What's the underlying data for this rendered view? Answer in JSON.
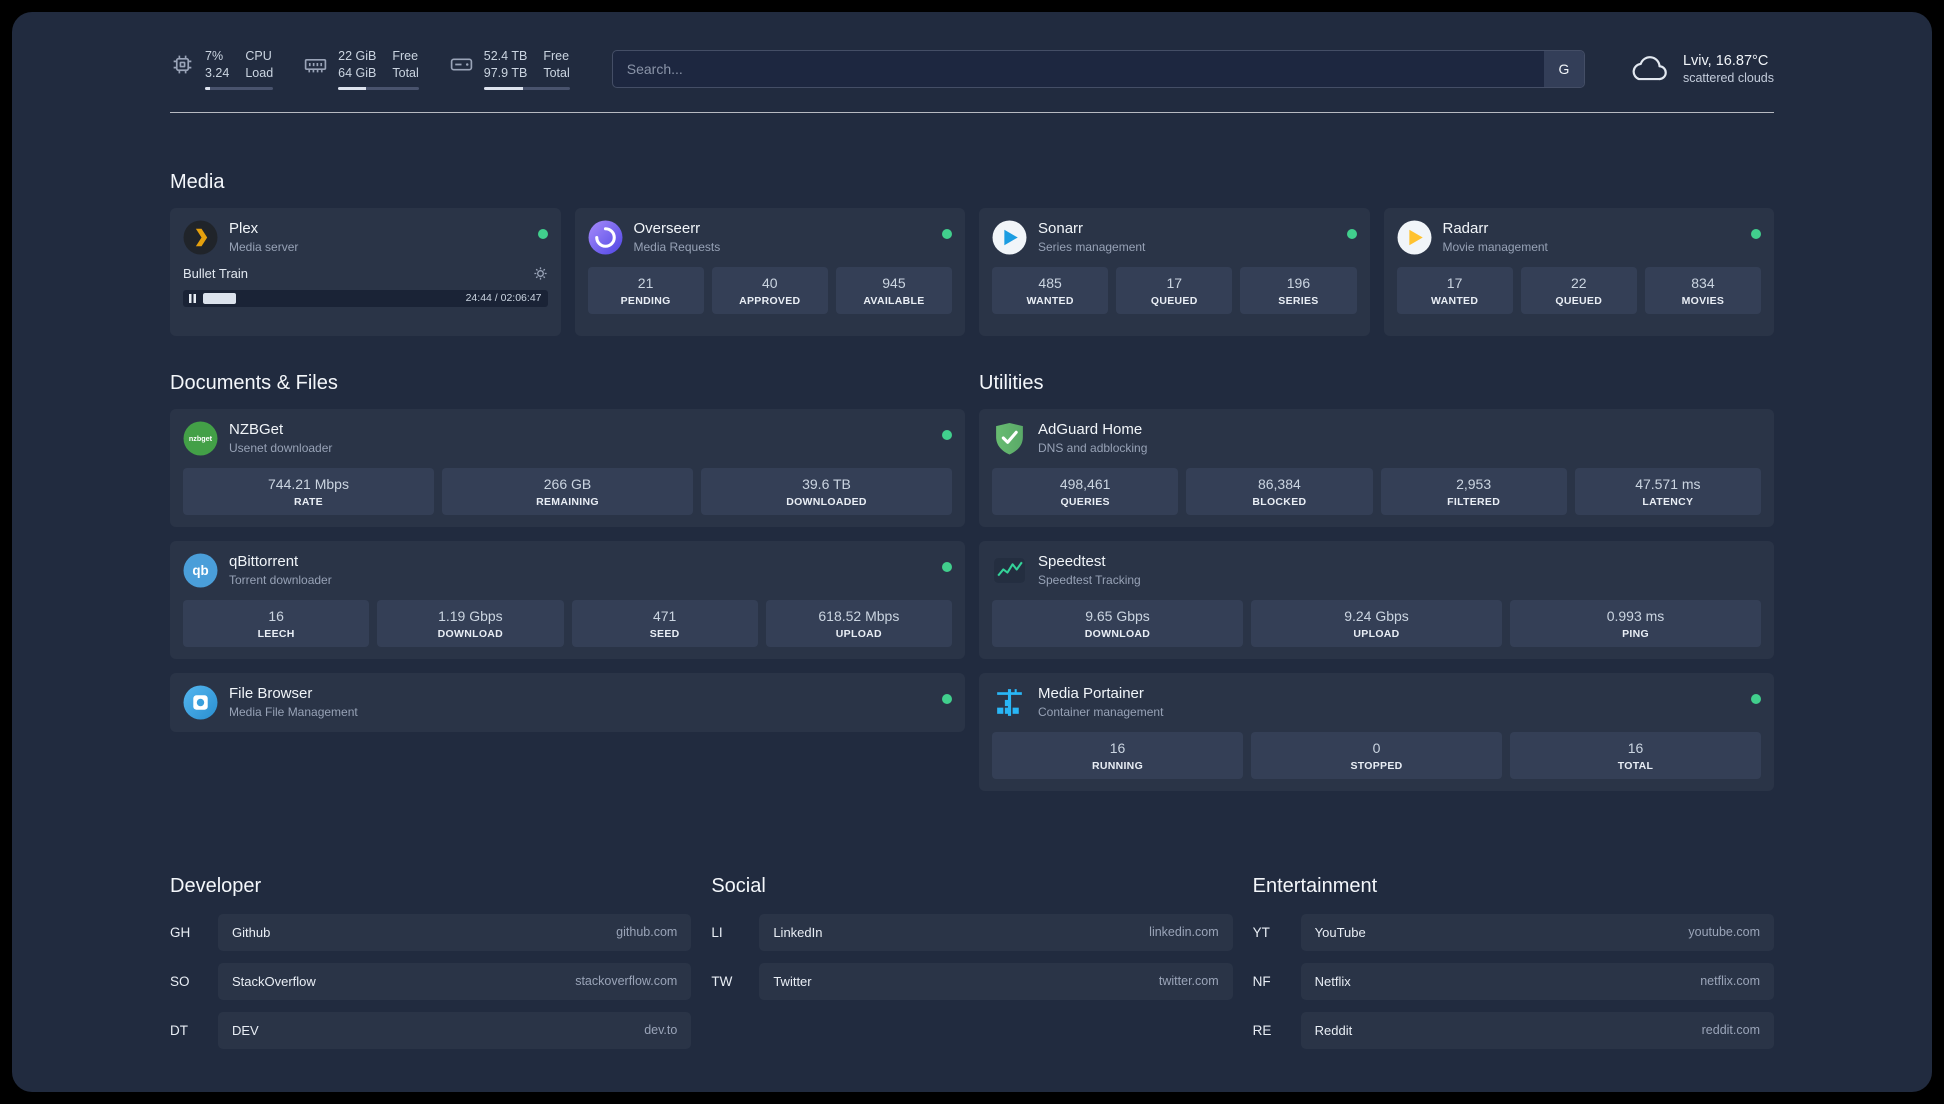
{
  "colors": {
    "accent_green": "#41cf8d",
    "page_bg": "#212b3f",
    "card_bg": "#2a3447",
    "stat_bg": "#343f56"
  },
  "header": {
    "monitors": [
      {
        "icon": "cpu-icon",
        "rows": [
          {
            "value": "7%",
            "label": "CPU"
          },
          {
            "value": "3.24",
            "label": "Load"
          }
        ],
        "progress_pct": 7
      },
      {
        "icon": "memory-icon",
        "rows": [
          {
            "value": "22 GiB",
            "label": "Free"
          },
          {
            "value": "64 GiB",
            "label": "Total"
          }
        ],
        "progress_pct": 35
      },
      {
        "icon": "disk-icon",
        "rows": [
          {
            "value": "52.4 TB",
            "label": "Free"
          },
          {
            "value": "97.9 TB",
            "label": "Total"
          }
        ],
        "progress_pct": 46
      }
    ],
    "search": {
      "placeholder": "Search...",
      "provider_button": "G"
    },
    "weather": {
      "icon": "cloud-icon",
      "location": "Lviv, 16.87°C",
      "condition": "scattered clouds"
    }
  },
  "sections": {
    "media": {
      "title": "Media",
      "plex": {
        "icon": "plex-icon",
        "name": "Plex",
        "subtitle": "Media server",
        "online": true,
        "now_playing": {
          "title": "Bullet Train",
          "time": "24:44 / 02:06:47",
          "progress_pct": 13
        }
      },
      "overseerr": {
        "icon": "overseerr-icon",
        "name": "Overseerr",
        "subtitle": "Media Requests",
        "online": true,
        "stats": [
          {
            "value": "21",
            "label": "PENDING"
          },
          {
            "value": "40",
            "label": "APPROVED"
          },
          {
            "value": "945",
            "label": "AVAILABLE"
          }
        ]
      },
      "sonarr": {
        "icon": "sonarr-icon",
        "name": "Sonarr",
        "subtitle": "Series management",
        "online": true,
        "stats": [
          {
            "value": "485",
            "label": "WANTED"
          },
          {
            "value": "17",
            "label": "QUEUED"
          },
          {
            "value": "196",
            "label": "SERIES"
          }
        ]
      },
      "radarr": {
        "icon": "radarr-icon",
        "name": "Radarr",
        "subtitle": "Movie management",
        "online": true,
        "stats": [
          {
            "value": "17",
            "label": "WANTED"
          },
          {
            "value": "22",
            "label": "QUEUED"
          },
          {
            "value": "834",
            "label": "MOVIES"
          }
        ]
      }
    },
    "documents": {
      "title": "Documents & Files",
      "nzbget": {
        "icon": "nzbget-icon",
        "icon_text": "nzbget",
        "name": "NZBGet",
        "subtitle": "Usenet downloader",
        "online": true,
        "stats": [
          {
            "value": "744.21 Mbps",
            "label": "RATE"
          },
          {
            "value": "266 GB",
            "label": "REMAINING"
          },
          {
            "value": "39.6 TB",
            "label": "DOWNLOADED"
          }
        ]
      },
      "qbittorrent": {
        "icon": "qbittorrent-icon",
        "icon_text": "qb",
        "name": "qBittorrent",
        "subtitle": "Torrent downloader",
        "online": true,
        "stats": [
          {
            "value": "16",
            "label": "LEECH"
          },
          {
            "value": "1.19 Gbps",
            "label": "DOWNLOAD"
          },
          {
            "value": "471",
            "label": "SEED"
          },
          {
            "value": "618.52 Mbps",
            "label": "UPLOAD"
          }
        ]
      },
      "filebrowser": {
        "icon": "filebrowser-icon",
        "name": "File Browser",
        "subtitle": "Media File Management",
        "online": true
      }
    },
    "utilities": {
      "title": "Utilities",
      "adguard": {
        "icon": "adguard-icon",
        "name": "AdGuard Home",
        "subtitle": "DNS and adblocking",
        "online": false,
        "stats": [
          {
            "value": "498,461",
            "label": "QUERIES"
          },
          {
            "value": "86,384",
            "label": "BLOCKED"
          },
          {
            "value": "2,953",
            "label": "FILTERED"
          },
          {
            "value": "47.571 ms",
            "label": "LATENCY"
          }
        ]
      },
      "speedtest": {
        "icon": "speedtest-icon",
        "name": "Speedtest",
        "subtitle": "Speedtest Tracking",
        "online": false,
        "stats": [
          {
            "value": "9.65 Gbps",
            "label": "DOWNLOAD"
          },
          {
            "value": "9.24 Gbps",
            "label": "UPLOAD"
          },
          {
            "value": "0.993 ms",
            "label": "PING"
          }
        ]
      },
      "portainer": {
        "icon": "portainer-icon",
        "name": "Media Portainer",
        "subtitle": "Container management",
        "online": true,
        "stats": [
          {
            "value": "16",
            "label": "RUNNING"
          },
          {
            "value": "0",
            "label": "STOPPED"
          },
          {
            "value": "16",
            "label": "TOTAL"
          }
        ]
      }
    }
  },
  "bookmarks": [
    {
      "title": "Developer",
      "links": [
        {
          "abbr": "GH",
          "name": "Github",
          "url": "github.com"
        },
        {
          "abbr": "SO",
          "name": "StackOverflow",
          "url": "stackoverflow.com"
        },
        {
          "abbr": "DT",
          "name": "DEV",
          "url": "dev.to"
        }
      ]
    },
    {
      "title": "Social",
      "links": [
        {
          "abbr": "LI",
          "name": "LinkedIn",
          "url": "linkedin.com"
        },
        {
          "abbr": "TW",
          "name": "Twitter",
          "url": "twitter.com"
        }
      ]
    },
    {
      "title": "Entertainment",
      "links": [
        {
          "abbr": "YT",
          "name": "YouTube",
          "url": "youtube.com"
        },
        {
          "abbr": "NF",
          "name": "Netflix",
          "url": "netflix.com"
        },
        {
          "abbr": "RE",
          "name": "Reddit",
          "url": "reddit.com"
        }
      ]
    }
  ]
}
